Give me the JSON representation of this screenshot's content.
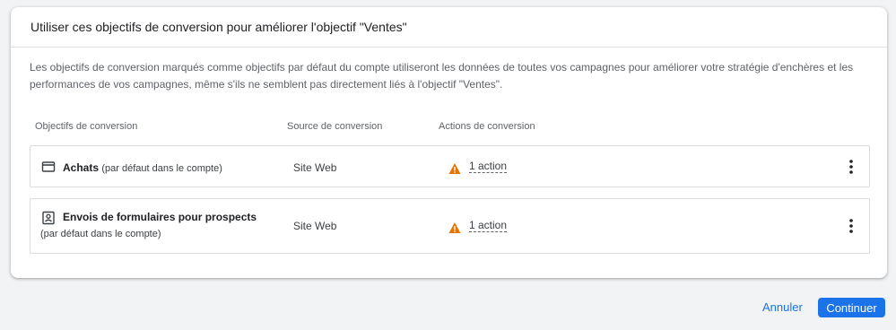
{
  "dialog": {
    "title": "Utiliser ces objectifs de conversion pour améliorer l'objectif \"Ventes\"",
    "description": "Les objectifs de conversion marqués comme objectifs par défaut du compte utiliseront les données de toutes vos campagnes pour améliorer votre stratégie d'enchères et les performances de vos campagnes, même s'ils ne semblent pas directement liés à l'objectif \"Ventes\"."
  },
  "table": {
    "columns": [
      "Objectifs de conversion",
      "Source de conversion",
      "Actions de conversion"
    ],
    "rows": [
      {
        "icon": "credit-card-icon",
        "name": "Achats",
        "default_note": "(par défaut dans le compte)",
        "source": "Site Web",
        "actions": "1 action"
      },
      {
        "icon": "contact-form-icon",
        "name": "Envois de formulaires pour prospects",
        "default_note": "(par défaut dans le compte)",
        "source": "Site Web",
        "actions": "1 action"
      }
    ]
  },
  "footer": {
    "cancel_label": "Annuler",
    "continue_label": "Continuer"
  },
  "colors": {
    "accent": "#1a73e8",
    "warning": "#e37400"
  }
}
